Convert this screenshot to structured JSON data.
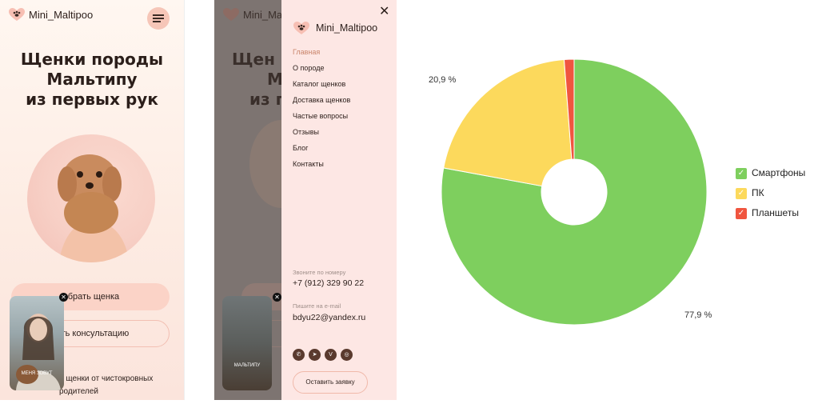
{
  "mobile_home": {
    "brand": "Mini_Maltipoo",
    "hero_lines": [
      "Щенки породы",
      "Мальтипу",
      "из первых рук"
    ],
    "cta_primary": "ыбрать щенка",
    "cta_secondary": "чить консультацию",
    "footer_lines": [
      "е щенки от чистокровных",
      "родителей"
    ],
    "video_caption": "МЕНЯ ЗОВУТ",
    "colors": {
      "accent": "#fbd3c7",
      "text": "#2b1e1a"
    }
  },
  "mobile_menu": {
    "dimmed_title_lines": [
      "Щен",
      "М",
      "из п"
    ],
    "dimmed_bottom": "МАЛЬТИПУ",
    "brand": "Mini_Maltipoo",
    "nav": [
      "Главная",
      "О породе",
      "Каталог щенков",
      "Доставка щенков",
      "Частые вопросы",
      "Отзывы",
      "Блог",
      "Контакты"
    ],
    "phone_label": "Звоните по номеру",
    "phone": "+7 (912) 329 90 22",
    "email_label": "Пишите на e-mail",
    "email": "bdyu22@yandex.ru",
    "social_icons": [
      "whatsapp-icon",
      "telegram-icon",
      "vk-icon",
      "instagram-icon"
    ],
    "request_button": "Оставить заявку"
  },
  "chart_data": {
    "type": "pie",
    "variant": "donut",
    "categories": [
      "Смартфоны",
      "ПК",
      "Планшеты"
    ],
    "values": [
      77.9,
      20.9,
      1.2
    ],
    "data_labels": [
      "77,9 %",
      "20,9 %",
      ""
    ],
    "colors": [
      "#7ecf5e",
      "#fcd95c",
      "#f0553f"
    ],
    "legend": "right",
    "title": ""
  }
}
